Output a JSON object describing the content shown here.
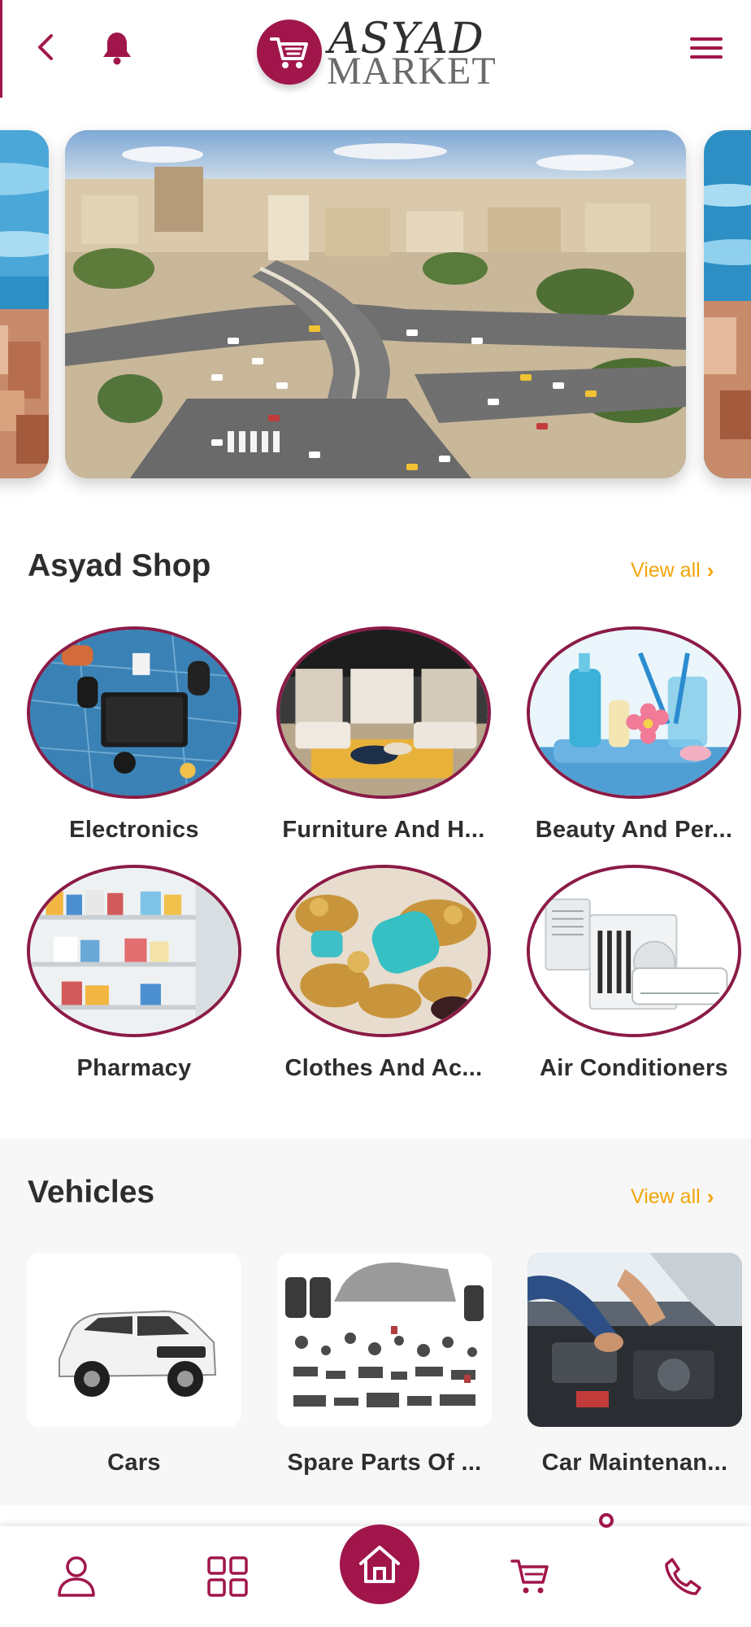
{
  "header": {
    "logo_line1": "ASYAD",
    "logo_line2": "MARKET",
    "icons": [
      "chevron-left-icon",
      "bell-icon",
      "hamburger-menu-icon"
    ]
  },
  "colors": {
    "brand": "#a0164a",
    "accent": "#f2a50a",
    "text": "#2d2d2d"
  },
  "shop": {
    "title": "Asyad Shop",
    "view_all": "View all",
    "items": [
      {
        "label": "Electronics"
      },
      {
        "label": "Furniture And H..."
      },
      {
        "label": "Beauty And Per..."
      },
      {
        "label": "Pharmacy"
      },
      {
        "label": "Clothes And Ac..."
      },
      {
        "label": "Air Conditioners"
      }
    ]
  },
  "vehicles": {
    "title": "Vehicles",
    "view_all": "View all",
    "items": [
      {
        "label": "Cars"
      },
      {
        "label": "Spare Parts Of ..."
      },
      {
        "label": "Car Maintenan..."
      }
    ]
  },
  "bottom_nav": {
    "items": [
      "user-icon",
      "grid-icon",
      "home-icon",
      "cart-icon",
      "phone-icon"
    ]
  }
}
